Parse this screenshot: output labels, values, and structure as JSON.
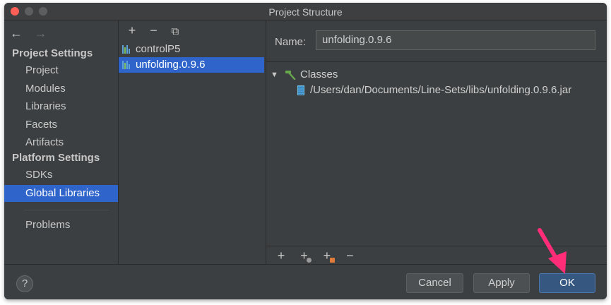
{
  "window": {
    "title": "Project Structure"
  },
  "nav": {
    "back_glyph": "←",
    "forward_glyph": "→",
    "project_settings_header": "Project Settings",
    "project_items": [
      "Project",
      "Modules",
      "Libraries",
      "Facets",
      "Artifacts"
    ],
    "platform_settings_header": "Platform Settings",
    "platform_items": [
      "SDKs",
      "Global Libraries"
    ],
    "selected_item": "Global Libraries",
    "problems": "Problems"
  },
  "libraries": {
    "toolbar": {
      "add": "+",
      "remove": "−",
      "copy": "⧉"
    },
    "items": [
      "controlP5",
      "unfolding.0.9.6"
    ],
    "selected": "unfolding.0.9.6"
  },
  "detail": {
    "name_label": "Name:",
    "name_value": "unfolding.0.9.6",
    "classes_label": "Classes",
    "jar_path": "/Users/dan/Documents/Line-Sets/libs/unfolding.0.9.6.jar",
    "toolbar": {
      "add": "+",
      "add_alt": "+",
      "add_other": "+",
      "remove": "−"
    }
  },
  "footer": {
    "help": "?",
    "cancel": "Cancel",
    "apply": "Apply",
    "ok": "OK"
  },
  "colors": {
    "background": "#3c3f41",
    "selection": "#2f65ca",
    "ok_button": "#365880",
    "annotation_arrow": "#ff2d78",
    "hammer": "#6aa84f"
  }
}
